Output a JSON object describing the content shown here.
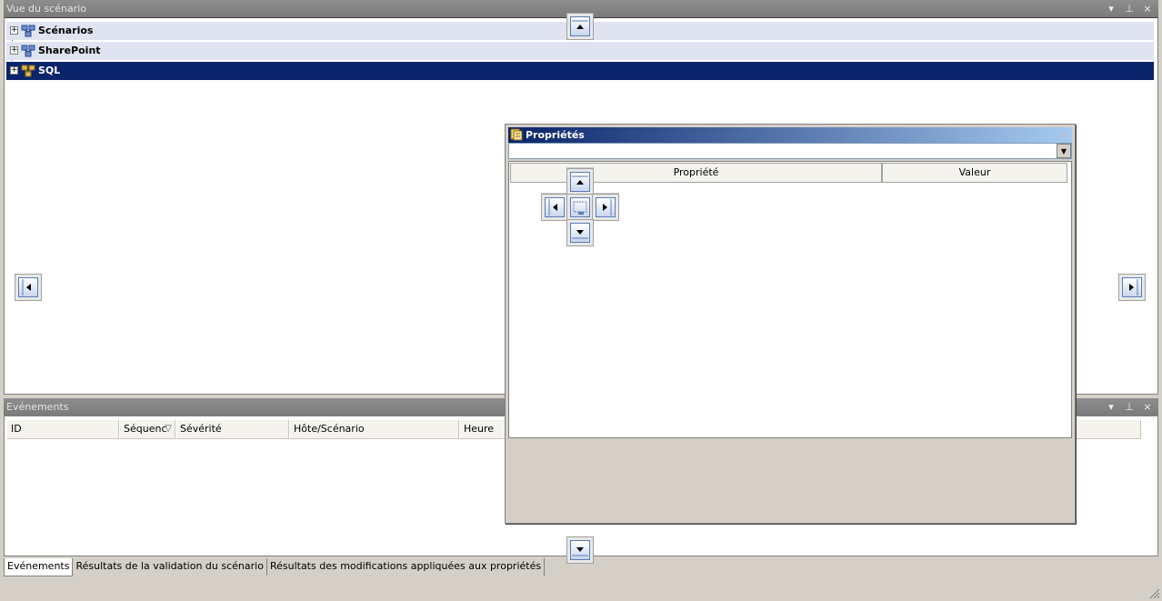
{
  "scenario_panel": {
    "title": "Vue du scénario",
    "tree": [
      {
        "label": "Scénarios",
        "expander": "+",
        "selected": false
      },
      {
        "label": "SharePoint",
        "expander": "+",
        "selected": false
      },
      {
        "label": "SQL",
        "expander": "+",
        "selected": true
      }
    ]
  },
  "events_panel": {
    "title": "Evénements",
    "columns": [
      "ID",
      "Séquenc",
      "Sévérité",
      "Hôte/Scénario",
      "Heure"
    ],
    "sort_indicator": "▽",
    "tabs": [
      {
        "label": "Evénements",
        "active": true
      },
      {
        "label": "Résultats de la validation du scénario",
        "active": false
      },
      {
        "label": "Résultats des modifications appliquées aux propriétés",
        "active": false
      }
    ]
  },
  "panel_controls": {
    "dropdown": "▾",
    "pin": "⊥",
    "close": "×"
  },
  "properties_window": {
    "title": "Propriétés",
    "close": "×",
    "combo_arrow": "▼",
    "grid_headers": {
      "property": "Propriété",
      "value": "Valeur"
    }
  },
  "colors": {
    "selection": "#0a246a",
    "tree_row": "#dfe4f0",
    "titlebar": "#7b7b7b"
  }
}
